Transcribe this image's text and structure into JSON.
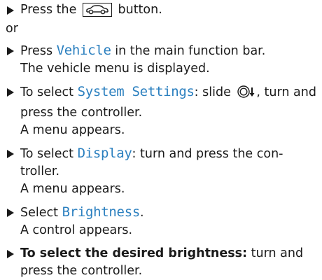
{
  "steps": [
    {
      "before": "Press the",
      "after": "button."
    },
    {
      "or": "or"
    },
    {
      "before": "Press",
      "menu": "Vehicle",
      "after": "in the main function bar.",
      "result": "The vehicle menu is displayed."
    },
    {
      "before": "To select",
      "menu": "System Settings",
      "after": ": slide",
      "after2": ", turn and press the controller.",
      "result": "A menu appears."
    },
    {
      "before": "To select",
      "menu": "Display",
      "after": ": turn and press the con-troller.",
      "result": "A menu appears."
    },
    {
      "before": "Select",
      "menu": "Brightness",
      "after": ".",
      "result": "A control appears."
    },
    {
      "bold": "To select the desired brightness:",
      "after": "turn and press the controller."
    }
  ],
  "icons": {
    "vehicle_button": "car-icon",
    "controller_slide": "controller-slide-down-icon"
  }
}
